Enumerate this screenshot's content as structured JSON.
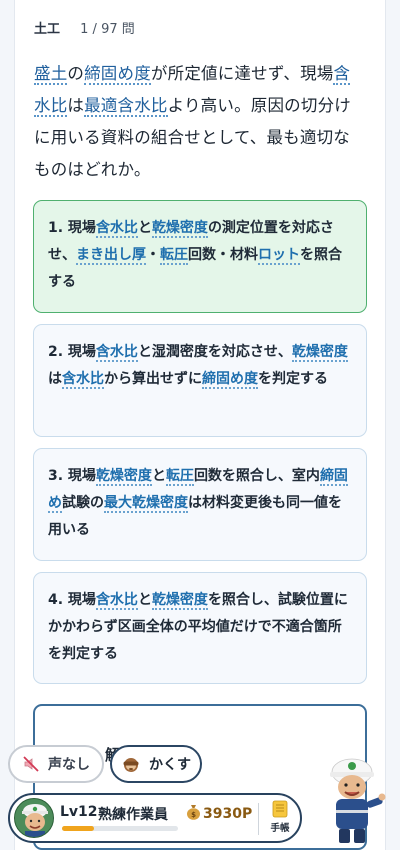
{
  "header": {
    "category": "土工",
    "progress": "1 / 97 問"
  },
  "question": [
    {
      "t": "盛土",
      "term": true
    },
    {
      "t": "の"
    },
    {
      "t": "締固め度",
      "term": true
    },
    {
      "t": "が所定値に達せず、現場"
    },
    {
      "t": "含水比",
      "term": true
    },
    {
      "t": "は"
    },
    {
      "t": "最適含水比",
      "term": true
    },
    {
      "t": "より高い。原因の切分けに用いる資料の組合せとして、最も適切なものはどれか。"
    }
  ],
  "options": [
    {
      "state": "selected",
      "segments": [
        {
          "t": "1. 現場"
        },
        {
          "t": "含水比",
          "term": true
        },
        {
          "t": "と"
        },
        {
          "t": "乾燥密度",
          "term": true
        },
        {
          "t": "の測定位置を対応させ、"
        },
        {
          "t": "まき出し厚",
          "term": true
        },
        {
          "t": "・"
        },
        {
          "t": "転圧",
          "term": true
        },
        {
          "t": "回数・材料"
        },
        {
          "t": "ロット",
          "term": true
        },
        {
          "t": "を照合する"
        }
      ]
    },
    {
      "state": "normal",
      "segments": [
        {
          "t": "2. 現場"
        },
        {
          "t": "含水比",
          "term": true
        },
        {
          "t": "と湿潤密度を対応させ、"
        },
        {
          "t": "乾燥密度",
          "term": true
        },
        {
          "t": "は"
        },
        {
          "t": "含水比",
          "term": true
        },
        {
          "t": "から算出せずに"
        },
        {
          "t": "締固め度",
          "term": true
        },
        {
          "t": "を判定する"
        }
      ]
    },
    {
      "state": "normal",
      "segments": [
        {
          "t": "3. 現場"
        },
        {
          "t": "乾燥密度",
          "term": true
        },
        {
          "t": "と"
        },
        {
          "t": "転圧",
          "term": true
        },
        {
          "t": "回数を照合し、室内"
        },
        {
          "t": "締固め",
          "term": true
        },
        {
          "t": "試験の"
        },
        {
          "t": "最大乾燥密度",
          "term": true
        },
        {
          "t": "は材料変更後も同一値を用いる"
        }
      ]
    },
    {
      "state": "normal",
      "segments": [
        {
          "t": "4. 現場"
        },
        {
          "t": "含水比",
          "term": true
        },
        {
          "t": "と"
        },
        {
          "t": "乾燥密度",
          "term": true
        },
        {
          "t": "を照合し、試験位置にかかわらず区画全体の平均値だけで不適合箇所を判定する"
        }
      ]
    }
  ],
  "answer_peek": "解",
  "controls": {
    "mute_label": "声なし",
    "hide_label": "かくす",
    "mute_icon": "speaker-muted-icon",
    "hide_icon": "see-no-evil-monkey-icon"
  },
  "player": {
    "level": "Lv12",
    "rank": "熟練作業員",
    "points": "3930P",
    "xp_fraction": 0.28,
    "notebook_label": "手帳",
    "notebook_icon": "notebook-icon",
    "points_icon": "money-bag-icon"
  },
  "colors": {
    "selected_bg": "#e4f6e9",
    "selected_border": "#4fb06f",
    "term": "#1f6fae",
    "xp": "#f0a41d"
  }
}
